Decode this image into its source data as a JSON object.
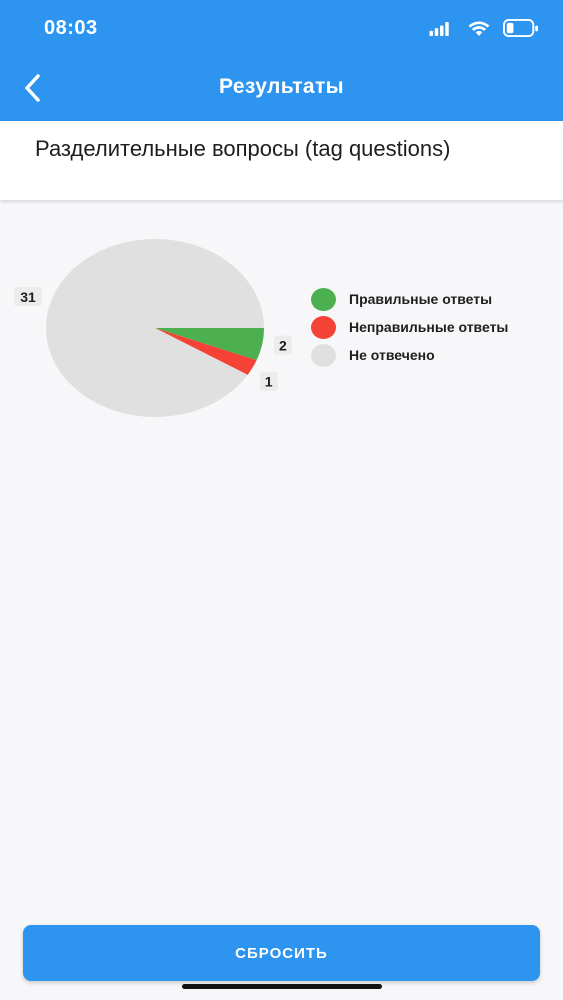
{
  "status_bar": {
    "time": "08:03"
  },
  "header": {
    "title": "Результаты",
    "back_icon": "chevron-left-icon"
  },
  "topic": {
    "title": "Разделительные вопросы (tag questions)"
  },
  "chart_data": {
    "type": "pie",
    "title": "",
    "slices": [
      {
        "label": "Правильные ответы",
        "value": 2,
        "color": "#4caf50"
      },
      {
        "label": "Неправильные ответы",
        "value": 1,
        "color": "#f44336"
      },
      {
        "label": "Не отвечено",
        "value": 31,
        "color": "#e0e0e0"
      }
    ],
    "legend_position": "right"
  },
  "reset_button": {
    "label": "СБРОСИТЬ"
  },
  "colors": {
    "accent": "#2d94f0",
    "background": "#f7f7f9"
  }
}
